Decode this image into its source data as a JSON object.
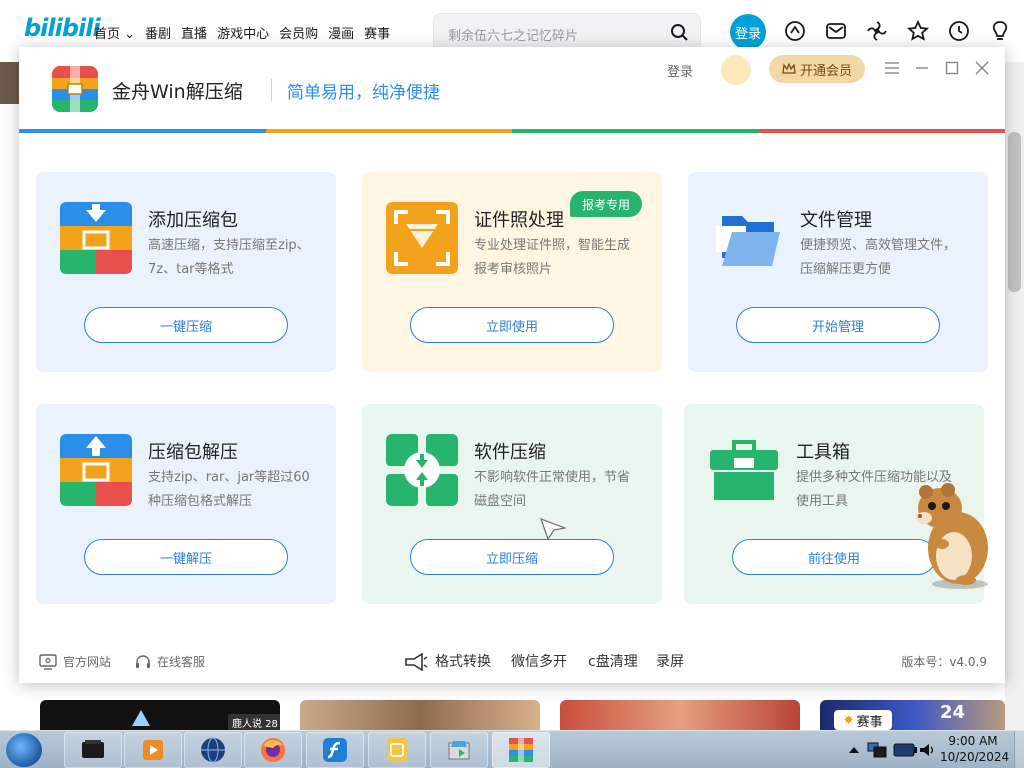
{
  "bilibili": {
    "logo": "bilibili",
    "nav": [
      "首页 ⌄",
      "番剧",
      "直播",
      "游戏中心",
      "会员购",
      "漫画",
      "赛事"
    ],
    "search": {
      "placeholder": "剩余伍六七之记忆碎片"
    },
    "login_label": "登录",
    "thumb_label": "鹿人说 28",
    "badge_label": "赛事",
    "icons": [
      "dynamic-icon",
      "message-icon",
      "fan-icon",
      "star-icon",
      "history-icon",
      "lightbulb-icon"
    ]
  },
  "app": {
    "title": "金舟Win解压缩",
    "slogan": "简单易用，纯净便捷",
    "login_label": "登录",
    "vip_label": "开通会员",
    "color_bar": [
      "#2b8ee8",
      "#f2a31b",
      "#27b56e",
      "#e8504b"
    ],
    "cards": [
      {
        "title": "添加压缩包",
        "desc": "高速压缩，支持压缩至zip、7z、tar等格式",
        "button": "一键压缩",
        "bg": "#eaf3fd",
        "icon": "archive-add-icon"
      },
      {
        "title": "证件照处理",
        "desc": "专业处理证件照，智能生成报考审核照片",
        "button": "立即使用",
        "tag": "报考专用",
        "bg": "#fef5e3",
        "icon": "id-photo-icon"
      },
      {
        "title": "文件管理",
        "desc": "便捷预览、高效管理文件，压缩解压更方便",
        "button": "开始管理",
        "bg": "#eaf3fd",
        "icon": "folder-icon"
      },
      {
        "title": "压缩包解压",
        "desc": "支持zip、rar、jar等超过60种压缩包格式解压",
        "button": "一键解压",
        "bg": "#eaf3fd",
        "icon": "archive-extract-icon"
      },
      {
        "title": "软件压缩",
        "desc": "不影响软件正常使用，节省磁盘空间",
        "button": "立即压缩",
        "bg": "#e8f6ee",
        "icon": "software-compress-icon"
      },
      {
        "title": "工具箱",
        "desc": "提供多种文件压缩功能以及使用工具",
        "button": "前往使用",
        "bg": "#e8f6ee",
        "icon": "toolbox-icon"
      }
    ],
    "footer": {
      "website": "官方网站",
      "support": "在线客服",
      "quick_links": [
        "格式转换",
        "微信多开",
        "c盘清理",
        "录屏"
      ],
      "version": "版本号：v4.0.9"
    }
  },
  "taskbar": {
    "time": "9:00 AM",
    "date": "10/20/2024"
  }
}
